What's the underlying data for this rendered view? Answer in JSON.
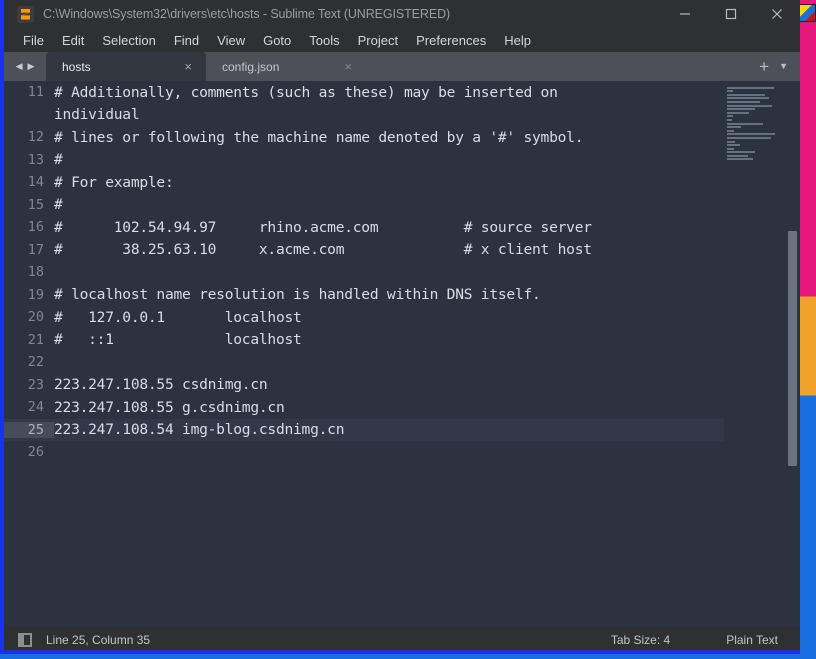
{
  "window": {
    "title": "C:\\Windows\\System32\\drivers\\etc\\hosts - Sublime Text (UNREGISTERED)",
    "logo_icon": "sublime-text-logo-icon",
    "controls": {
      "minimize": "minimize-icon",
      "maximize": "maximize-icon",
      "close": "close-icon"
    }
  },
  "menubar": {
    "items": [
      {
        "label": "File"
      },
      {
        "label": "Edit"
      },
      {
        "label": "Selection"
      },
      {
        "label": "Find"
      },
      {
        "label": "View"
      },
      {
        "label": "Goto"
      },
      {
        "label": "Tools"
      },
      {
        "label": "Project"
      },
      {
        "label": "Preferences"
      },
      {
        "label": "Help"
      }
    ]
  },
  "tabbar": {
    "nav_prev_icon": "chevron-left-icon",
    "nav_next_icon": "chevron-right-icon",
    "tabs": [
      {
        "label": "hosts",
        "active": true,
        "close_icon": "×"
      },
      {
        "label": "config.json",
        "active": false,
        "close_icon": "×"
      }
    ],
    "new_tab_label": "+",
    "menu_label": "▼"
  },
  "editor": {
    "current_line": 25,
    "lines": [
      {
        "no": "11",
        "text": "# Additionally, comments (such as these) may be inserted on"
      },
      {
        "no": "",
        "text": "individual"
      },
      {
        "no": "12",
        "text": "# lines or following the machine name denoted by a '#' symbol."
      },
      {
        "no": "13",
        "text": "#"
      },
      {
        "no": "14",
        "text": "# For example:"
      },
      {
        "no": "15",
        "text": "#"
      },
      {
        "no": "16",
        "text": "#      102.54.94.97     rhino.acme.com          # source server"
      },
      {
        "no": "17",
        "text": "#       38.25.63.10     x.acme.com              # x client host"
      },
      {
        "no": "18",
        "text": ""
      },
      {
        "no": "19",
        "text": "# localhost name resolution is handled within DNS itself."
      },
      {
        "no": "20",
        "text": "#   127.0.0.1       localhost"
      },
      {
        "no": "21",
        "text": "#   ::1             localhost"
      },
      {
        "no": "22",
        "text": ""
      },
      {
        "no": "23",
        "text": "223.247.108.55 csdnimg.cn"
      },
      {
        "no": "24",
        "text": "223.247.108.55 g.csdnimg.cn"
      },
      {
        "no": "25",
        "text": "223.247.108.54 img-blog.csdnimg.cn"
      },
      {
        "no": "26",
        "text": ""
      }
    ],
    "minimap_line_widths": [
      47,
      6,
      38,
      42,
      33,
      45,
      28,
      22,
      6,
      5,
      36,
      14,
      7,
      48,
      44,
      8,
      13,
      7,
      28,
      21,
      26
    ],
    "scrollbar": "vertical-scrollbar"
  },
  "statusbar": {
    "sidebar_icon": "sidebar-toggle-icon",
    "position": "Line 25, Column 35",
    "tab_size": "Tab Size: 4",
    "syntax": "Plain Text"
  },
  "colors": {
    "editor_background": "#2b3240",
    "chrome_background": "#2f3033",
    "tabbar_background": "#4d5056",
    "window_border": "#1b32e8",
    "accent_orange": "#fa9b0c",
    "text_primary": "#d5dde6",
    "text_muted": "#7d8795",
    "current_line_background": "#313949"
  }
}
